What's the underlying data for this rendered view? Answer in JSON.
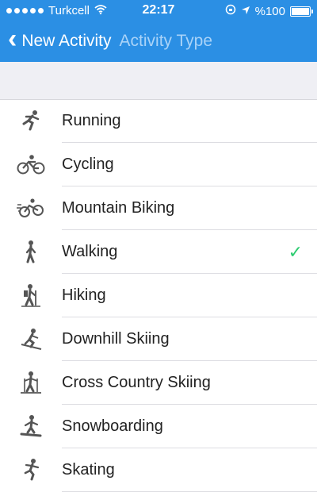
{
  "status_bar": {
    "carrier": "Turkcell",
    "time": "22:17",
    "battery": "%100",
    "battery_level": 1.0
  },
  "nav": {
    "back_label": "New Activity",
    "title": "Activity Type"
  },
  "activities": [
    {
      "label": "Running",
      "icon": "running-icon",
      "selected": false
    },
    {
      "label": "Cycling",
      "icon": "cycling-icon",
      "selected": false
    },
    {
      "label": "Mountain Biking",
      "icon": "mountain-biking-icon",
      "selected": false
    },
    {
      "label": "Walking",
      "icon": "walking-icon",
      "selected": true
    },
    {
      "label": "Hiking",
      "icon": "hiking-icon",
      "selected": false
    },
    {
      "label": "Downhill Skiing",
      "icon": "downhill-skiing-icon",
      "selected": false
    },
    {
      "label": "Cross Country Skiing",
      "icon": "cross-country-skiing-icon",
      "selected": false
    },
    {
      "label": "Snowboarding",
      "icon": "snowboarding-icon",
      "selected": false
    },
    {
      "label": "Skating",
      "icon": "skating-icon",
      "selected": false
    }
  ],
  "check_mark": "✓",
  "colors": {
    "nav_bg": "#2b8fe4",
    "title_text": "#a9d3f8",
    "check": "#2ecc71"
  }
}
